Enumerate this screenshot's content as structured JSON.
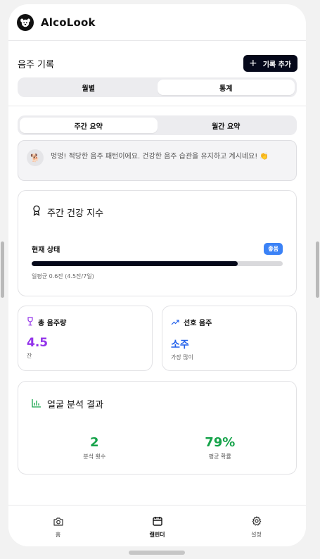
{
  "app": {
    "title": "AlcoLook"
  },
  "records": {
    "title": "음주 기록",
    "add_button": "기록 추가",
    "view_tabs": [
      {
        "label": "월별",
        "active": false
      },
      {
        "label": "통계",
        "active": true
      }
    ]
  },
  "summary_tabs": [
    {
      "label": "주간 요약",
      "active": true
    },
    {
      "label": "월간 요약",
      "active": false
    }
  ],
  "tip": {
    "emoji": "🐕",
    "text": "멍멍! 적당한 음주 패턴이에요. 건강한 음주 습관을 유지하고 계시네요! 👏"
  },
  "health": {
    "title": "주간 건강 지수",
    "status_label": "현재 상태",
    "status_badge": "좋음",
    "progress_fraction": 0.82,
    "average_text": "일평균 0.6잔 (4.5잔/7일)"
  },
  "stats": {
    "total": {
      "label": "총 음주량",
      "value": "4.5",
      "unit": "잔"
    },
    "preferred": {
      "label": "선호 음주",
      "value": "소주",
      "sub": "가장 많이"
    }
  },
  "face_analysis": {
    "title": "얼굴 분석 결과",
    "count_value": "2",
    "count_label": "분석 횟수",
    "prob_value": "79%",
    "prob_label": "평균 확률"
  },
  "tabbar": [
    {
      "label": "홈",
      "icon": "camera-icon",
      "active": false
    },
    {
      "label": "캘린더",
      "icon": "calendar-icon",
      "active": true
    },
    {
      "label": "설정",
      "icon": "gear-icon",
      "active": false
    }
  ],
  "colors": {
    "accent_dark": "#05081a",
    "badge_blue": "#3b82f6",
    "total_purple": "#9333ea",
    "preferred_blue": "#2563eb",
    "face_green": "#16a34a"
  }
}
